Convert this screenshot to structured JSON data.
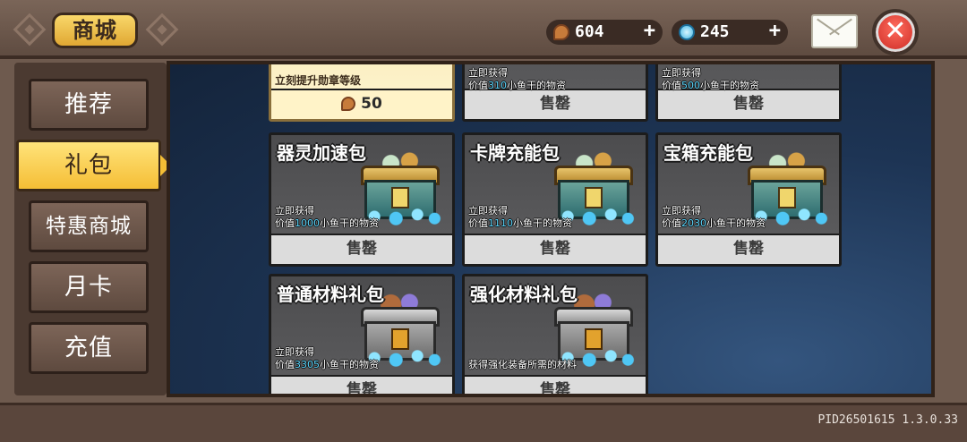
{
  "header": {
    "title": "商城",
    "currency_fish": {
      "value": "604",
      "plus": "+",
      "icon": "fish-icon"
    },
    "currency_gem": {
      "value": "245",
      "plus": "+",
      "icon": "gem-icon"
    },
    "mail_icon": "mail-icon",
    "close_label": "✕"
  },
  "sidebar": {
    "items": [
      {
        "label": "推荐"
      },
      {
        "label": "礼包"
      },
      {
        "label": "特惠商城"
      },
      {
        "label": "月卡"
      },
      {
        "label": "充值"
      }
    ]
  },
  "cards": [
    {
      "title": "",
      "desc1": "立刻提升勋章等级",
      "desc2_pre": "",
      "desc2_val": "",
      "desc2_post": "",
      "price": "50",
      "style": "gold"
    },
    {
      "title": "",
      "desc1": "立即获得",
      "desc2_pre": "价值",
      "desc2_val": "310",
      "desc2_post": "小鱼干的物资",
      "price": "售罄"
    },
    {
      "title": "",
      "desc1": "立即获得",
      "desc2_pre": "价值",
      "desc2_val": "500",
      "desc2_post": "小鱼干的物资",
      "price": "售罄"
    },
    {
      "title": "器灵加速包",
      "desc1": "立即获得",
      "desc2_pre": "价值",
      "desc2_val": "1000",
      "desc2_post": "小鱼干的物资",
      "price": "售罄"
    },
    {
      "title": "卡牌充能包",
      "desc1": "立即获得",
      "desc2_pre": "价值",
      "desc2_val": "1110",
      "desc2_post": "小鱼干的物资",
      "price": "售罄"
    },
    {
      "title": "宝箱充能包",
      "desc1": "立即获得",
      "desc2_pre": "价值",
      "desc2_val": "2030",
      "desc2_post": "小鱼干的物资",
      "price": "售罄"
    },
    {
      "title": "普通材料礼包",
      "desc1": "立即获得",
      "desc2_pre": "价值",
      "desc2_val": "3305",
      "desc2_post": "小鱼干的物资",
      "price": "售罄"
    },
    {
      "title": "强化材料礼包",
      "desc1": "",
      "desc2_pre": "获得强化装备所需的材料",
      "desc2_val": "",
      "desc2_post": "",
      "price": "售罄"
    }
  ],
  "version": "PID26501615 1.3.0.33"
}
